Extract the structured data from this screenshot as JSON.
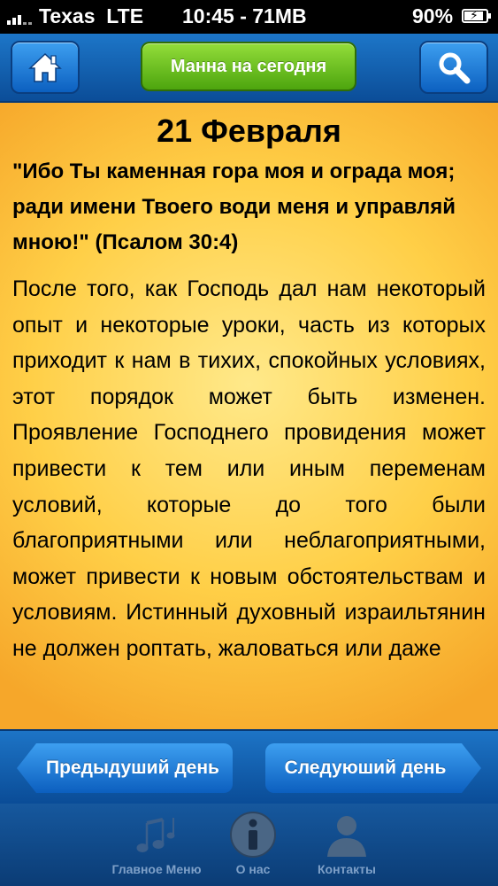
{
  "status_bar": {
    "carrier": "Texas",
    "network": "LTE",
    "time_memory": "10:45 - 71MB",
    "battery": "90%",
    "battery_level": 0.9
  },
  "nav": {
    "title": "Манна на сегодня",
    "home_icon": "home-icon",
    "search_icon": "search-icon"
  },
  "content": {
    "date": "21 Февраля",
    "verse": "\"Ибо Ты каменная гора моя и ограда моя; ради имени Твоего води меня и управляй мною!\" (Псалом 30:4)",
    "body": "После того, как Господь дал нам некоторый опыт и некоторые уроки, часть из которых приходит к нам в тихих, спокойных условиях, этот порядок может быть изменен. Проявление Господнего провидения может привести к тем или иным переменам условий, которые до того были благоприятными или неблагоприятными, может привести к новым обстоятельствам и условиям. Истинный духовный израильтянин не должен роптать, жаловаться или даже"
  },
  "day_nav": {
    "prev": "Предыдуший день",
    "next": "Следуюший день"
  },
  "tabs": [
    {
      "label": "Главное Меню",
      "icon": "music-notes-icon"
    },
    {
      "label": "О нас",
      "icon": "info-icon"
    },
    {
      "label": "Контакты",
      "icon": "person-icon"
    }
  ],
  "colors": {
    "nav_blue": "#0b4d98",
    "title_green": "#5fb51a",
    "content_yellow": "#ffd84f",
    "tab_label": "#7ea0c8"
  }
}
